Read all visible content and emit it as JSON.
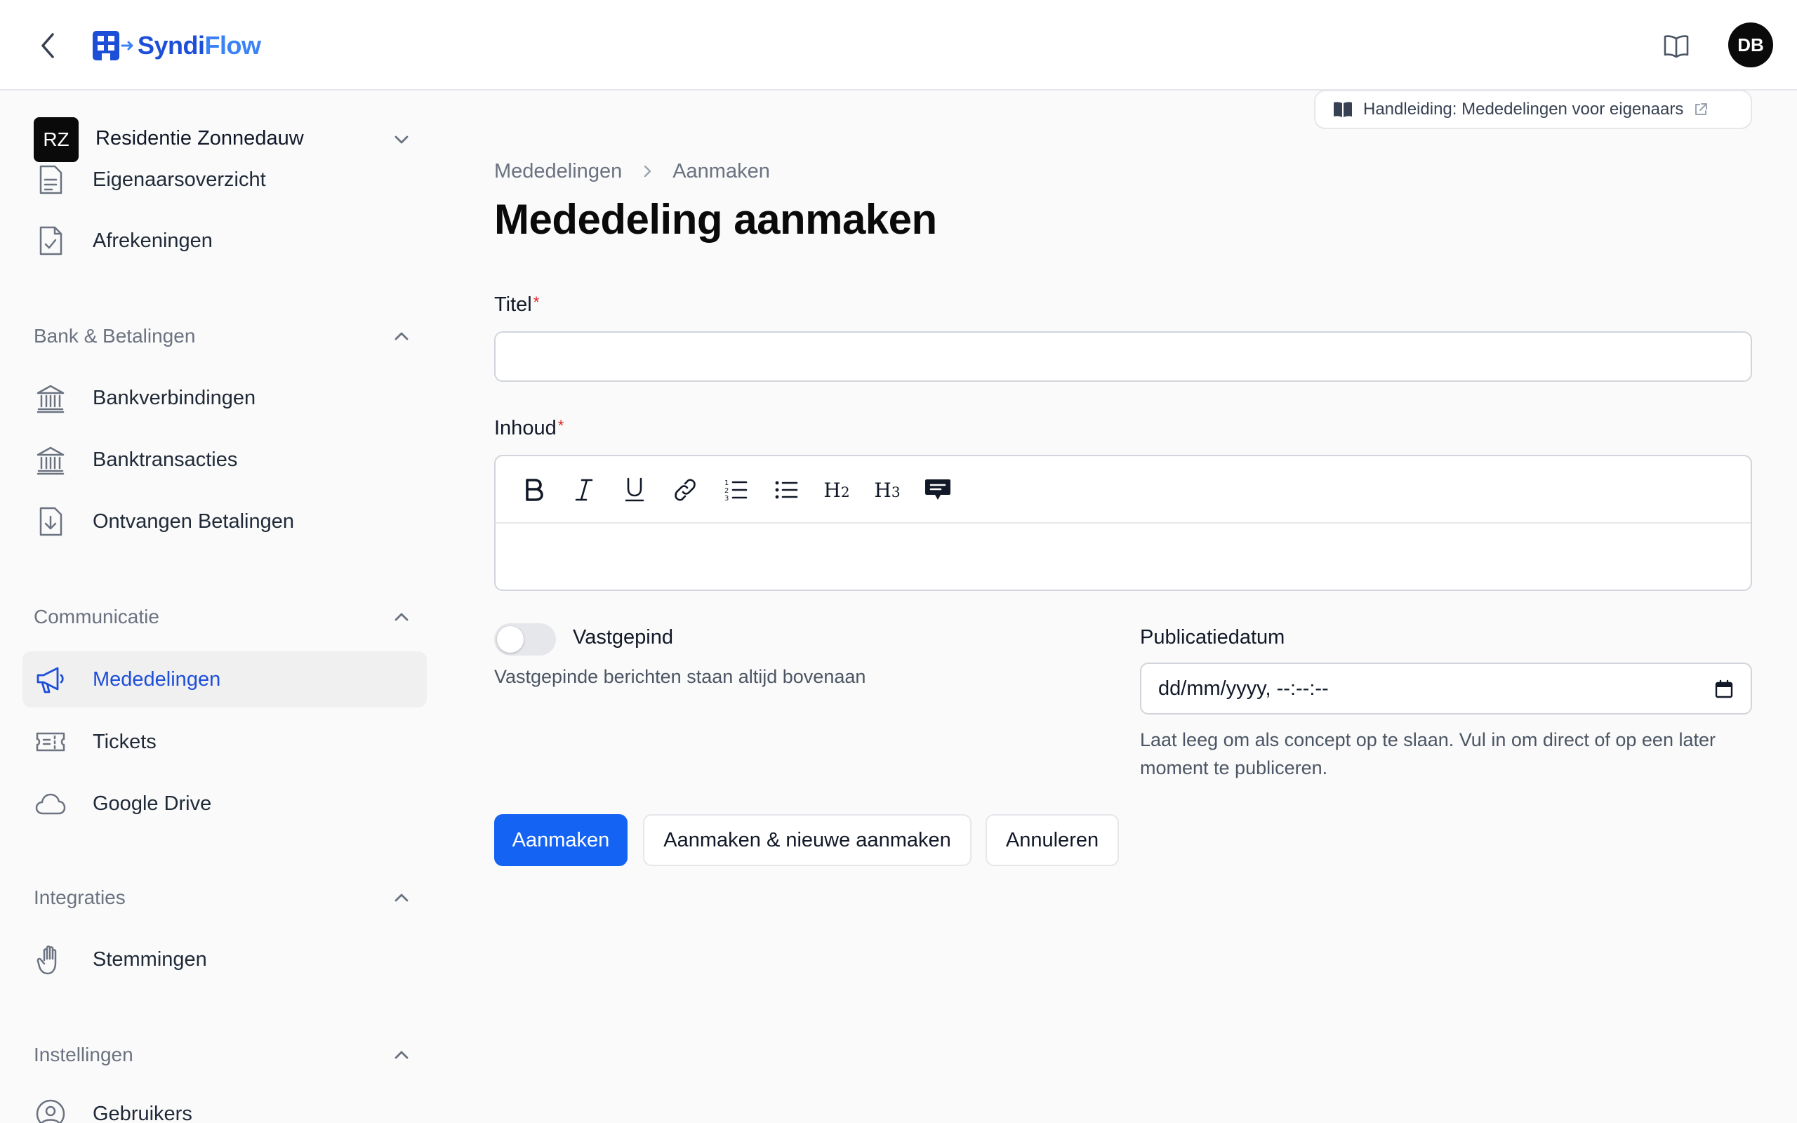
{
  "app": {
    "logo_brand_a": "Syndi",
    "logo_brand_b": "Flow",
    "user_initials": "DB",
    "accent_color": "#1463f3",
    "brand_color": "#1d4ed8"
  },
  "sidebar": {
    "tenant": {
      "initials": "RZ",
      "name": "Residentie Zonnedauw"
    },
    "items_top": [
      {
        "label": "Eigenaarsoverzicht",
        "icon": "document-list-icon"
      },
      {
        "label": "Afrekeningen",
        "icon": "document-check-icon"
      }
    ],
    "groups": [
      {
        "label": "Bank & Betalingen",
        "items": [
          {
            "label": "Bankverbindingen",
            "icon": "bank-icon"
          },
          {
            "label": "Banktransacties",
            "icon": "bank-icon"
          },
          {
            "label": "Ontvangen Betalingen",
            "icon": "document-download-icon"
          }
        ]
      },
      {
        "label": "Communicatie",
        "items": [
          {
            "label": "Mededelingen",
            "icon": "megaphone-icon",
            "active": true
          },
          {
            "label": "Tickets",
            "icon": "ticket-icon"
          },
          {
            "label": "Google Drive",
            "icon": "cloud-icon"
          }
        ]
      },
      {
        "label": "Integraties",
        "items": [
          {
            "label": "Stemmingen",
            "icon": "hand-icon"
          }
        ]
      },
      {
        "label": "Instellingen",
        "items": [
          {
            "label": "Gebruikers",
            "icon": "user-circle-icon"
          }
        ]
      }
    ]
  },
  "main": {
    "manual_link": "Handleiding: Mededelingen voor eigenaars",
    "breadcrumb": [
      "Mededelingen",
      "Aanmaken"
    ],
    "title": "Mededeling aanmaken",
    "form": {
      "title_label": "Titel",
      "title_value": "",
      "content_label": "Inhoud",
      "required_marker": "*",
      "toolbar": [
        "bold",
        "italic",
        "underline",
        "link",
        "ordered-list",
        "bullet-list",
        "heading-2",
        "heading-3",
        "comment"
      ],
      "toolbar_h2": "H",
      "toolbar_h3": "H",
      "toolbar_h2_sub": "2",
      "toolbar_h3_sub": "3",
      "pinned_label": "Vastgepind",
      "pinned_value": false,
      "pinned_help": "Vastgepinde berichten staan altijd bovenaan",
      "pubdate_label": "Publicatiedatum",
      "pubdate_value": "dd/mm/yyyy, --:--:--",
      "pubdate_help": "Laat leeg om als concept op te slaan. Vul in om direct of op een later moment te publiceren."
    },
    "buttons": {
      "create": "Aanmaken",
      "create_another": "Aanmaken & nieuwe aanmaken",
      "cancel": "Annuleren"
    }
  }
}
